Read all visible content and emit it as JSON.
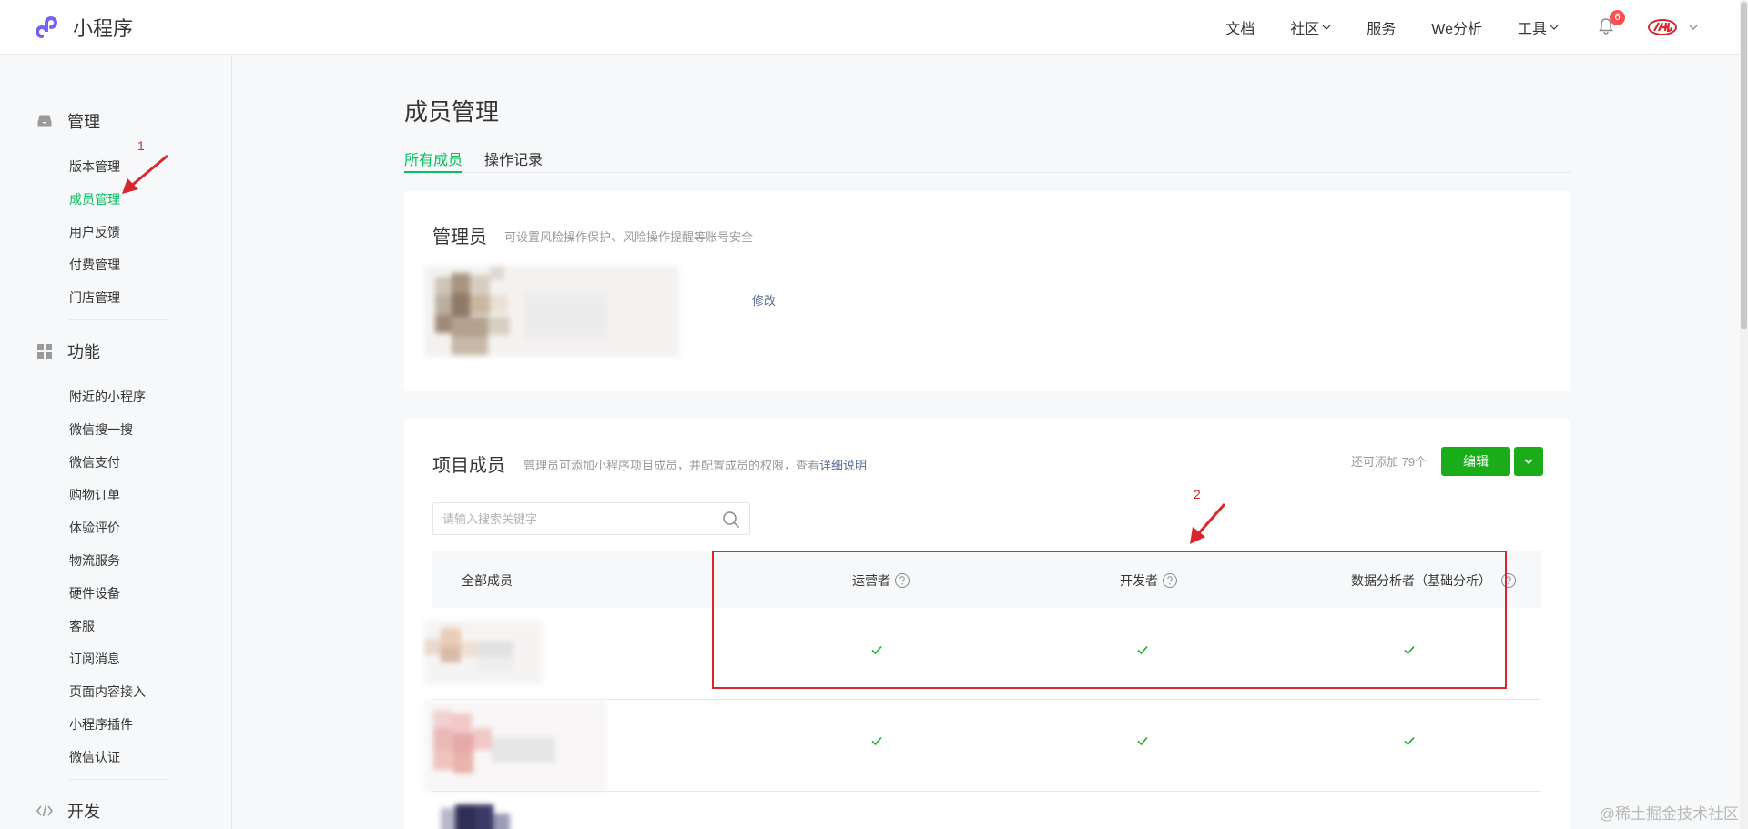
{
  "app": {
    "name": "小程序"
  },
  "topnav": {
    "items": [
      "文档",
      "社区",
      "服务",
      "We分析",
      "工具"
    ],
    "notification_count": "6"
  },
  "sidebar": {
    "manage": {
      "title": "管理",
      "items": [
        "版本管理",
        "成员管理",
        "用户反馈",
        "付费管理",
        "门店管理"
      ]
    },
    "features": {
      "title": "功能",
      "items": [
        "附近的小程序",
        "微信搜一搜",
        "微信支付",
        "购物订单",
        "体验评价",
        "物流服务",
        "硬件设备",
        "客服",
        "订阅消息",
        "页面内容接入",
        "小程序插件",
        "微信认证"
      ]
    },
    "develop": {
      "title": "开发"
    }
  },
  "page": {
    "title": "成员管理",
    "tabs": [
      "所有成员",
      "操作记录"
    ]
  },
  "admin_card": {
    "title": "管理员",
    "desc": "可设置风险操作保护、风险操作提醒等账号安全",
    "edit_link": "修改"
  },
  "members_card": {
    "title": "项目成员",
    "desc": "管理员可添加小程序项目成员，并配置成员的权限，查看",
    "desc_link": "详细说明",
    "remaining": "还可添加 79个",
    "edit_button": "编辑",
    "search_placeholder": "请输入搜索关键字",
    "columns": [
      "全部成员",
      "运营者",
      "开发者",
      "数据分析者（基础分析）"
    ],
    "rows": [
      {
        "operator": true,
        "developer": true,
        "analyst": true
      },
      {
        "operator": true,
        "developer": true,
        "analyst": true
      }
    ]
  },
  "annotations": {
    "label_1": "1",
    "label_2": "2"
  },
  "watermark": "@稀土掘金技术社区"
}
